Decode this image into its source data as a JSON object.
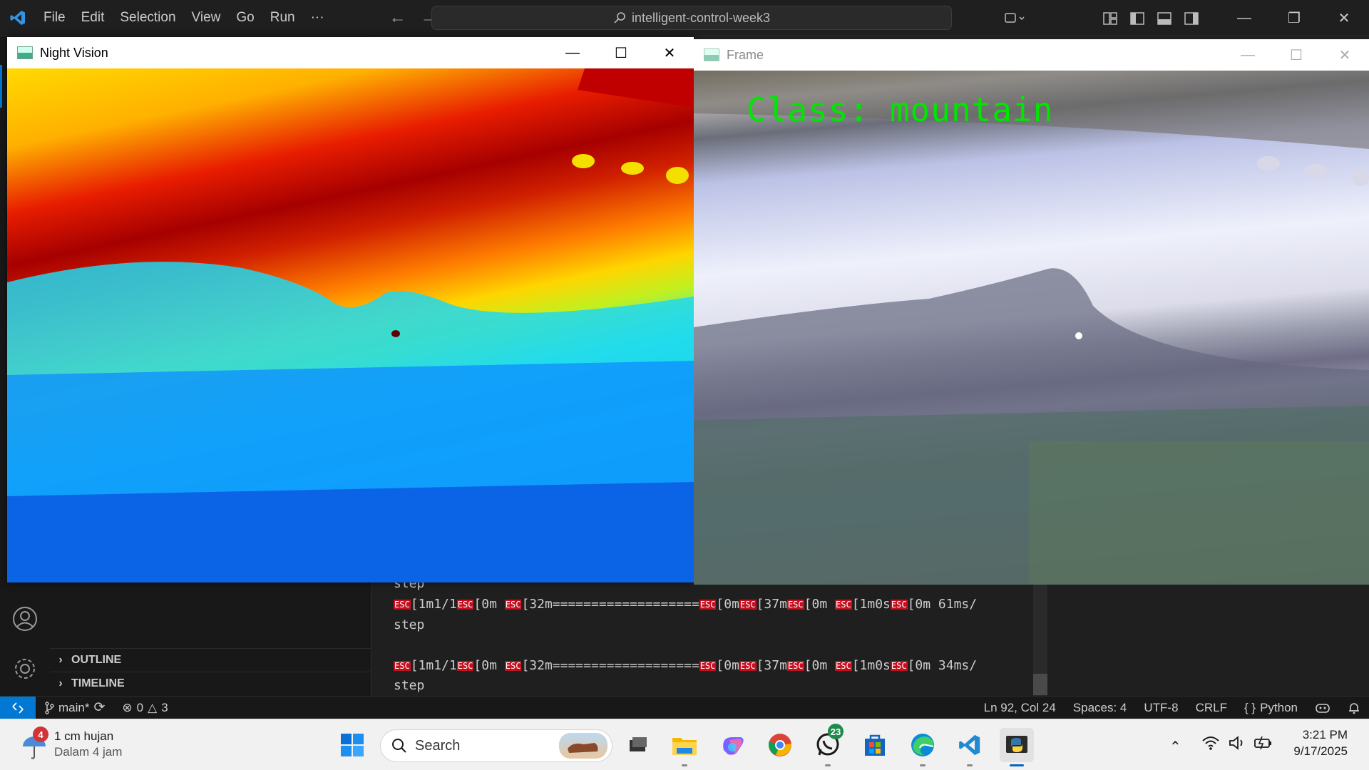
{
  "vscode": {
    "menu": [
      "File",
      "Edit",
      "Selection",
      "View",
      "Go",
      "Run",
      "···"
    ],
    "search_text": "intelligent-control-week3",
    "sidebar_sections": [
      "OUTLINE",
      "TIMELINE"
    ],
    "terminal": {
      "line0": "step",
      "line1": {
        "a": "[1m1/1",
        "b": "[0m ",
        "c": "[32m===================",
        "d": "[0m",
        "e": "[37m",
        "f": "[0m ",
        "g": "[1m0s",
        "h": "[0m 61ms/"
      },
      "line2": "step",
      "line3": {
        "a": "[1m1/1",
        "b": "[0m ",
        "c": "[32m===================",
        "d": "[0m",
        "e": "[37m",
        "f": "[0m ",
        "g": "[1m0s",
        "h": "[0m 34ms/"
      },
      "line4": "step",
      "esc_label": "ESC"
    },
    "statusbar": {
      "branch": "main*",
      "errors": "0",
      "warnings": "3",
      "cursor": "Ln 92, Col 24",
      "spaces": "Spaces: 4",
      "encoding": "UTF-8",
      "eol": "CRLF",
      "language": "Python"
    }
  },
  "windows": {
    "night_vision_title": "Night Vision",
    "frame_title": "Frame",
    "class_label": "Class: mountain"
  },
  "taskbar": {
    "weather_badge": "4",
    "weather_line1": "1 cm hujan",
    "weather_line2": "Dalam 4 jam",
    "search_placeholder": "Search",
    "whatsapp_badge": "23",
    "time": "3:21 PM",
    "date": "9/17/2025"
  },
  "colors": {
    "accent": "#0078d4",
    "class_label": "#00e600",
    "esc_bg": "#c50f1f"
  }
}
